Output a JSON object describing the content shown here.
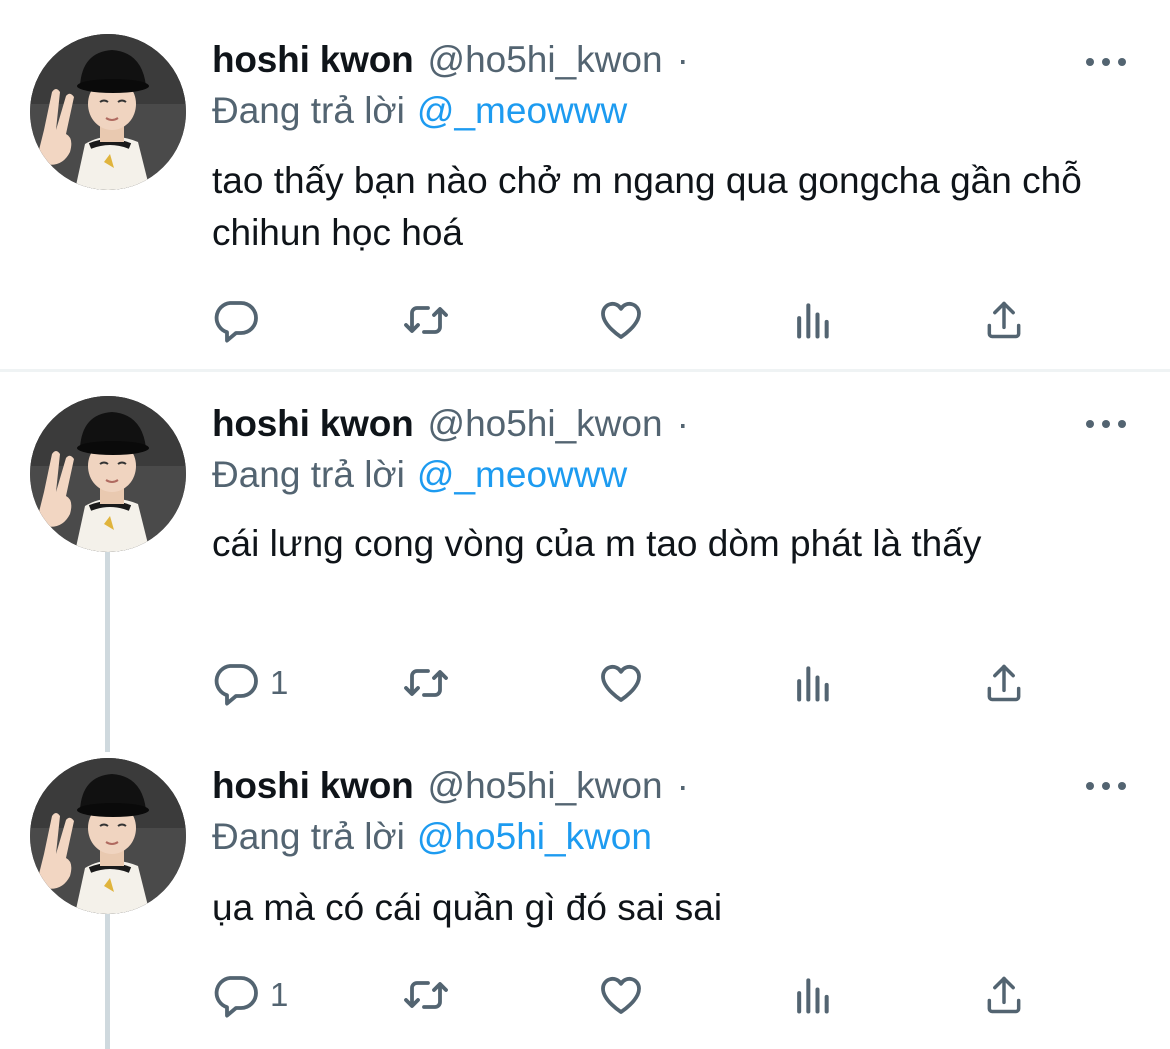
{
  "colors": {
    "text": "#0f1419",
    "muted": "#536471",
    "link": "#1d9bf0",
    "thread_line": "#cfd9de"
  },
  "icons": {
    "reply": "reply-icon",
    "retweet": "retweet-icon",
    "like": "heart-icon",
    "views": "views-icon",
    "share": "share-icon",
    "more": "more-icon"
  },
  "tweets": [
    {
      "name": "hoshi kwon",
      "handle": "@ho5hi_kwon",
      "dot": "·",
      "reply_prefix": "Đang trả lời",
      "reply_to": "@_meowww",
      "text": "tao thấy bạn nào chở m ngang qua gongcha gần chỗ chihun học hoá",
      "reply_count": ""
    },
    {
      "name": "hoshi kwon",
      "handle": "@ho5hi_kwon",
      "dot": "·",
      "reply_prefix": "Đang trả lời",
      "reply_to": "@_meowww",
      "text": "cái lưng cong vòng của m tao dòm phát là thấy",
      "reply_count": "1"
    },
    {
      "name": "hoshi kwon",
      "handle": "@ho5hi_kwon",
      "dot": "·",
      "reply_prefix": "Đang trả lời",
      "reply_to": "@ho5hi_kwon",
      "text": "ụa mà có cái quần gì đó sai sai",
      "reply_count": "1"
    }
  ]
}
